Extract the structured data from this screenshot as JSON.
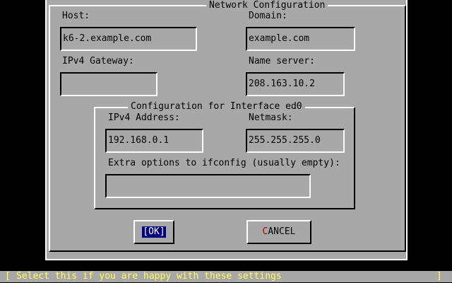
{
  "dialog": {
    "title": "Network Configuration",
    "labels": {
      "host": "Host:",
      "domain": "Domain:",
      "gateway": "IPv4 Gateway:",
      "nameserver": "Name server:"
    },
    "values": {
      "host": "k6-2.example.com",
      "domain": "example.com",
      "gateway": "",
      "nameserver": "208.163.10.2"
    }
  },
  "interface": {
    "title": "Configuration for Interface ed0",
    "labels": {
      "ipv4": "IPv4 Address:",
      "netmask": "Netmask:",
      "extra": "Extra options to ifconfig (usually empty):"
    },
    "values": {
      "ipv4": "192.168.0.1",
      "netmask": "255.255.255.0",
      "extra": ""
    }
  },
  "buttons": {
    "ok_label": "[OK]",
    "cancel_hotkey": "C",
    "cancel_rest": "ANCEL"
  },
  "status": {
    "left_bracket": "[",
    "message": "Select this if you are happy with these settings",
    "right_bracket": "]"
  },
  "colors": {
    "dialog_bg": "#a8a8a8",
    "screen_bg": "#000000",
    "status_text": "#ffff54",
    "focus_bg": "#000080",
    "hotkey": "#a80000"
  }
}
